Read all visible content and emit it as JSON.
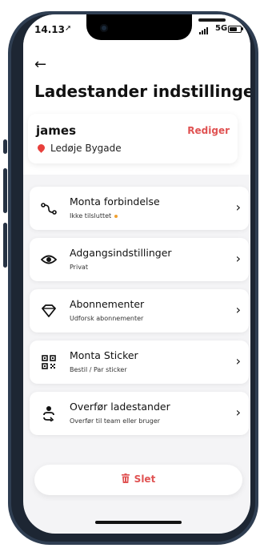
{
  "status_bar": {
    "time": "14.13",
    "network": "5G"
  },
  "header": {
    "back_icon": "back-arrow-icon",
    "title": "Ladestander indstillinger"
  },
  "station": {
    "name": "james",
    "edit_label": "Rediger",
    "address": "Ledøje Bygade"
  },
  "settings": [
    {
      "icon": "connection-icon",
      "title": "Monta forbindelse",
      "subtitle": "Ikke tilsluttet"
    },
    {
      "icon": "eye-icon",
      "title": "Adgangsindstillinger",
      "subtitle": "Privat"
    },
    {
      "icon": "diamond-icon",
      "title": "Abonnementer",
      "subtitle": "Udforsk abonnementer"
    },
    {
      "icon": "qr-code-icon",
      "title": "Monta Sticker",
      "subtitle": "Bestil / Par sticker"
    },
    {
      "icon": "transfer-icon",
      "title": "Overfør ladestander",
      "subtitle": "Overfør til team eller bruger"
    }
  ],
  "delete": {
    "label": "Slet",
    "icon": "trash-icon"
  },
  "colors": {
    "accent": "#e05252",
    "status_dot": "#f0a030"
  }
}
